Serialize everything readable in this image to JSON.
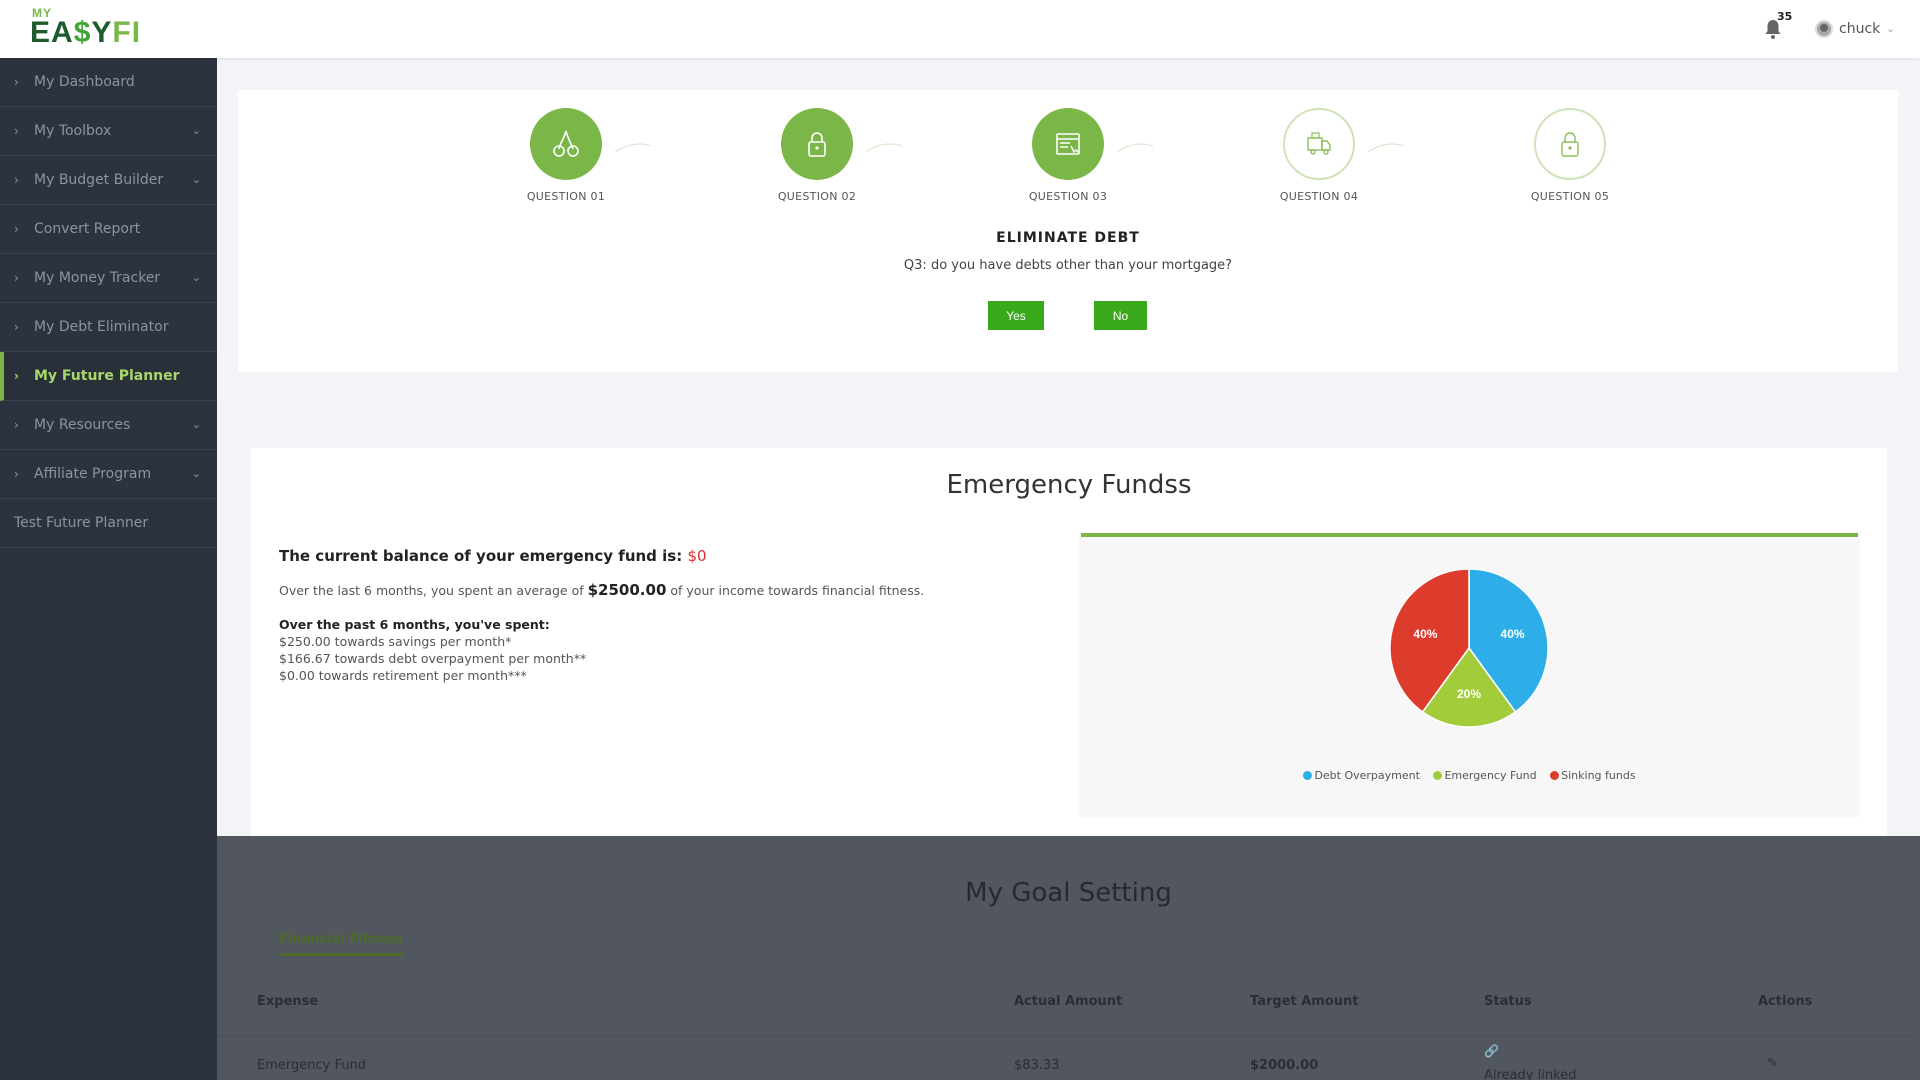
{
  "logo": {
    "my": "MY",
    "ea": "EA",
    "dollar": "$",
    "y": "Y",
    "fi": "FI"
  },
  "header": {
    "notifications_count": "35",
    "user_name": "chuck"
  },
  "sidebar": {
    "items": [
      {
        "label": "My Dashboard"
      },
      {
        "label": "My Toolbox"
      },
      {
        "label": "My Budget Builder"
      },
      {
        "label": "Convert Report"
      },
      {
        "label": "My Money Tracker"
      },
      {
        "label": "My Debt Eliminator"
      },
      {
        "label": "My Future Planner"
      },
      {
        "label": "My Resources"
      },
      {
        "label": "Affiliate Program"
      },
      {
        "label": "Test Future Planner"
      }
    ]
  },
  "questions": {
    "steps": [
      {
        "label": "QUESTION 01",
        "icon": "cherries-icon"
      },
      {
        "label": "QUESTION 02",
        "icon": "lock-icon"
      },
      {
        "label": "QUESTION 03",
        "icon": "store-icon"
      },
      {
        "label": "QUESTION 04",
        "icon": "truck-icon"
      },
      {
        "label": "QUESTION 05",
        "icon": "lock-icon"
      }
    ],
    "title": "ELIMINATE DEBT",
    "text": "Q3: do you have debts other than your mortgage?",
    "yes_label": "Yes",
    "no_label": "No"
  },
  "emergency": {
    "title": "Emergency Fundss",
    "balance_label": "The current balance of your emergency fund is:",
    "balance_value": "$0",
    "avg_prefix": "Over the last 6 months, you spent an average of",
    "avg_value": "$2500.00",
    "avg_suffix": "of your income towards financial fitness.",
    "spent_heading": "Over the past 6 months, you've spent:",
    "spent_lines": [
      "$250.00 towards savings per month*",
      "$166.67 towards debt overpayment per month**",
      "$0.00 towards retirement per month***"
    ]
  },
  "chart_data": {
    "type": "pie",
    "categories": [
      "Debt Overpayment",
      "Emergency Fund",
      "Sinking funds"
    ],
    "values": [
      40,
      20,
      40
    ],
    "labels": [
      "40%",
      "20%",
      "40%"
    ],
    "colors": [
      "#2eaee8",
      "#a3cc3b",
      "#dd3b2c"
    ],
    "legend_position": "bottom"
  },
  "goals": {
    "title": "My Goal Setting",
    "tab_label": "Financial Fitness",
    "columns": [
      "Expense",
      "Actual Amount",
      "Target Amount",
      "Status",
      "Actions"
    ],
    "rows": [
      {
        "expense": "Emergency Fund",
        "actual": "$83.33",
        "target": "$2000.00",
        "status": "Already linked"
      }
    ]
  },
  "colors": {
    "accent": "#7ab648",
    "sidebar_bg": "#2d333e",
    "button": "#3aaa1c",
    "danger": "#d9302e"
  }
}
